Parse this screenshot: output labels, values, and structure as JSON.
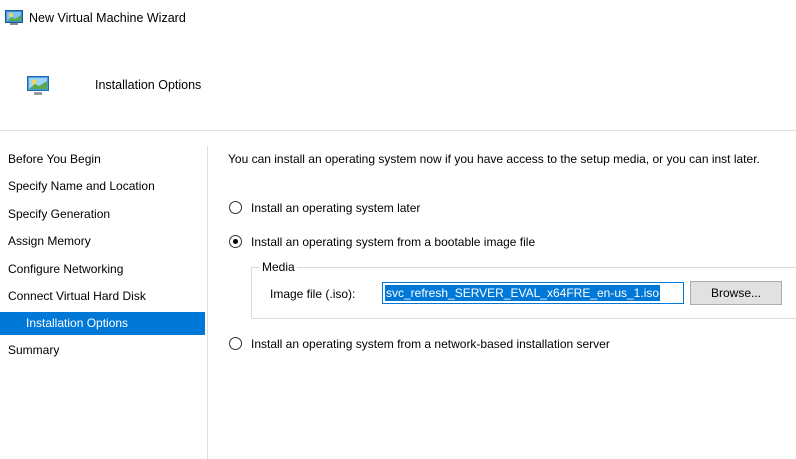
{
  "window": {
    "title": "New Virtual Machine Wizard",
    "icon": "vm-computer-icon"
  },
  "header": {
    "title": "Installation Options",
    "icon": "monitor-icon"
  },
  "nav": {
    "items": [
      {
        "label": "Before You Begin",
        "selected": false
      },
      {
        "label": "Specify Name and Location",
        "selected": false
      },
      {
        "label": "Specify Generation",
        "selected": false
      },
      {
        "label": "Assign Memory",
        "selected": false
      },
      {
        "label": "Configure Networking",
        "selected": false
      },
      {
        "label": "Connect Virtual Hard Disk",
        "selected": false
      },
      {
        "label": "Installation Options",
        "selected": true
      },
      {
        "label": "Summary",
        "selected": false
      }
    ]
  },
  "main": {
    "intro": "You can install an operating system now if you have access to the setup media, or you can inst later.",
    "options": [
      {
        "label": "Install an operating system later",
        "checked": false
      },
      {
        "label": "Install an operating system from a bootable image file",
        "checked": true
      },
      {
        "label": "Install an operating system from a network-based installation server",
        "checked": false
      }
    ],
    "media": {
      "legend": "Media",
      "image_label": "Image file (.iso):",
      "image_value": "svc_refresh_SERVER_EVAL_x64FRE_en-us_1.iso",
      "browse_label": "Browse..."
    }
  },
  "colors": {
    "accent": "#0078d7",
    "divider": "#dfdfdf",
    "button_face": "#e1e1e1"
  }
}
